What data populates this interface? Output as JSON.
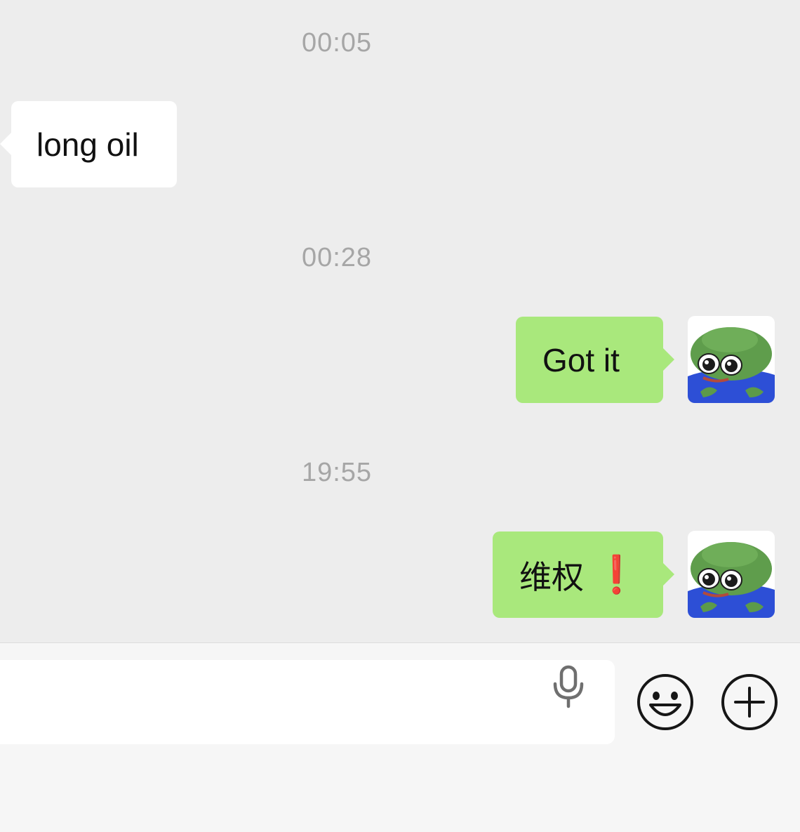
{
  "messages": [
    {
      "type": "timestamp",
      "text": "00:05"
    },
    {
      "type": "incoming",
      "text": "long oil"
    },
    {
      "type": "timestamp",
      "text": "00:28"
    },
    {
      "type": "outgoing",
      "text": "Got it",
      "avatar_icon": "frog-avatar-icon"
    },
    {
      "type": "timestamp",
      "text": "19:55"
    },
    {
      "type": "outgoing",
      "text": "维权",
      "emoji": "❗",
      "avatar_icon": "frog-avatar-icon"
    }
  ],
  "input_bar": {
    "value": "",
    "icons": [
      "microphone-icon",
      "emoji-icon",
      "plus-icon"
    ]
  },
  "colors": {
    "chat_background": "#ededed",
    "incoming_bubble": "#ffffff",
    "outgoing_bubble": "#a9e87c",
    "timestamp_text": "#a6a6a6",
    "input_bar_background": "#f6f6f6"
  }
}
